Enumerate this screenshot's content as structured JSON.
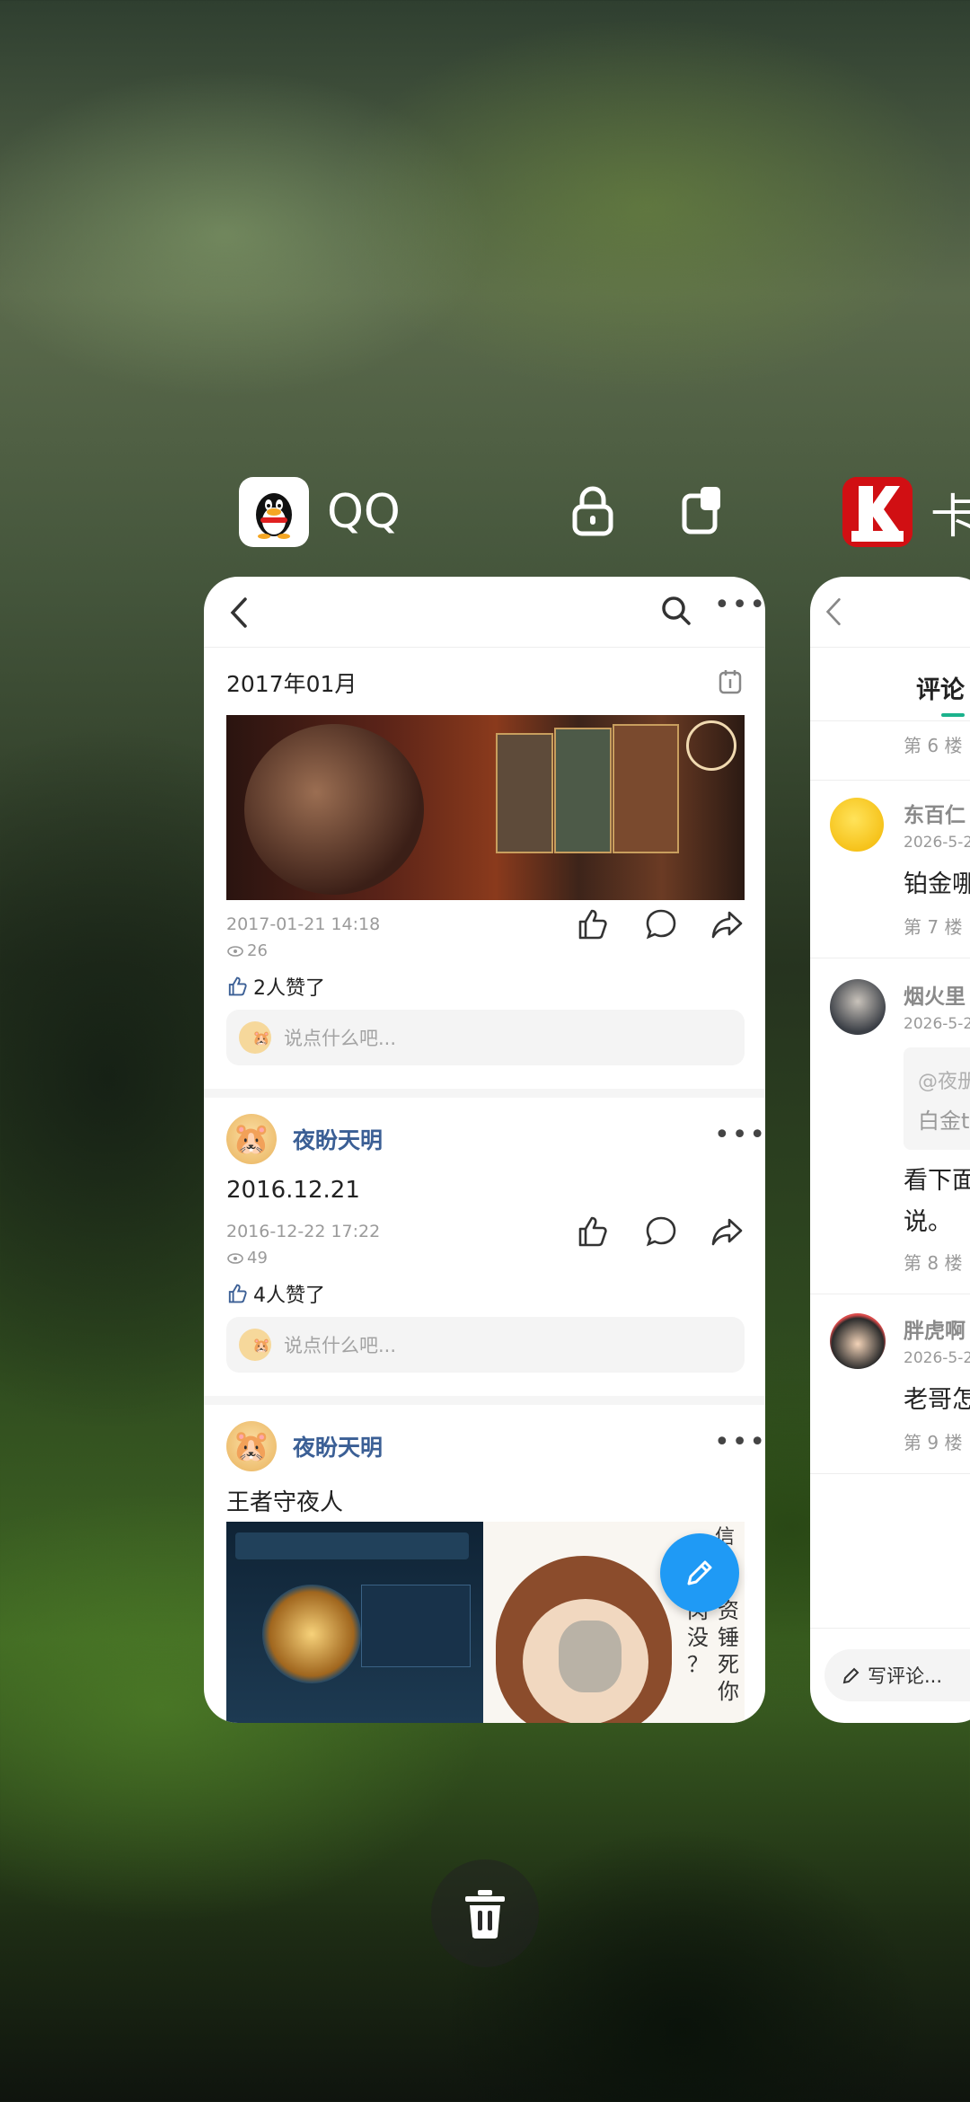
{
  "recents": {
    "primary_app": {
      "name": "QQ"
    },
    "secondary_app": {
      "name": "卡"
    },
    "qq_card": {
      "timeline_month": "2017年01月",
      "post1": {
        "date": "2017-01-21 14:18",
        "views": "26",
        "likes": "2人赞了",
        "comment_placeholder": "说点什么吧..."
      },
      "post2": {
        "user": "夜盼天明",
        "text": "2016.12.21",
        "date": "2016-12-22 17:22",
        "views": "49",
        "likes": "4人赞了",
        "comment_placeholder": "说点什么吧..."
      },
      "post3": {
        "user": "夜盼天明",
        "text": "王者守夜人",
        "meme_text": [
          "信",
          "资",
          "锤",
          "死",
          "你",
          "肉",
          "没",
          "？"
        ]
      }
    },
    "side_card": {
      "tab": "评论",
      "floor_6": "第 6 楼",
      "c1": {
        "user": "东百仁",
        "date": "2026-5-2",
        "text": "铂金哪",
        "floor": "第 7 楼"
      },
      "c2": {
        "user": "烟火里",
        "date": "2026-5-2",
        "quote1": "@夜册",
        "quote2": "白金t",
        "text1": "看下面",
        "text2": "说。",
        "floor": "第 8 楼"
      },
      "c3": {
        "user": "胖虎啊",
        "date": "2026-5-2",
        "text": "老哥怎",
        "floor": "第 9 楼"
      },
      "write_comment": "写评论..."
    }
  }
}
